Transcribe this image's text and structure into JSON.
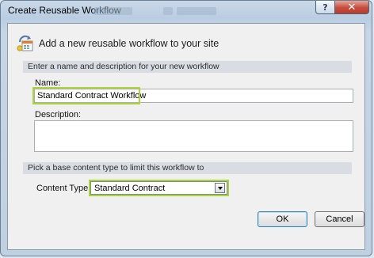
{
  "window": {
    "title": "Create Reusable Workflow"
  },
  "titlebar": {
    "help_label": "?",
    "close_label": "✕"
  },
  "header": {
    "text": "Add a new reusable workflow to your site",
    "icon": "workflow-icon"
  },
  "sections": {
    "name_desc": "Enter a name and description for your new workflow",
    "content_type": "Pick a base content type to limit this workflow to"
  },
  "fields": {
    "name_label": "Name:",
    "name_value": "Standard Contract Workflow",
    "description_label": "Description:",
    "description_value": "",
    "content_type_label": "Content Type:",
    "content_type_value": "Standard Contract"
  },
  "buttons": {
    "ok": "OK",
    "cancel": "Cancel"
  },
  "colors": {
    "highlight": "#a9d43b",
    "close_button": "#c64d3c"
  }
}
